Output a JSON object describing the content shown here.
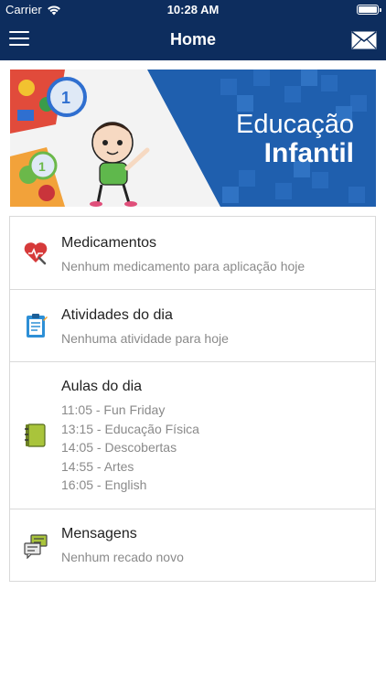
{
  "status_bar": {
    "carrier": "Carrier",
    "time": "10:28 AM"
  },
  "nav": {
    "title": "Home",
    "menu_icon": "hamburger-icon",
    "mail_icon": "envelope-icon"
  },
  "banner": {
    "line1": "Educação",
    "line2": "Infantil"
  },
  "sections": {
    "medicamentos": {
      "title": "Medicamentos",
      "subtitle": "Nenhum medicamento para aplicação hoje",
      "icon": "heart-pill-icon"
    },
    "atividades": {
      "title": "Atividades do dia",
      "subtitle": "Nenhuma atividade para hoje",
      "icon": "clipboard-icon"
    },
    "aulas": {
      "title": "Aulas do dia",
      "icon": "notebook-icon",
      "items": [
        "11:05 - Fun Friday",
        "13:15 - Educação Física",
        "14:05 - Descobertas",
        "14:55 - Artes",
        "16:05 - English"
      ]
    },
    "mensagens": {
      "title": "Mensagens",
      "subtitle": "Nenhum recado novo",
      "icon": "chat-bubbles-icon"
    }
  },
  "colors": {
    "nav_bg": "#0d2d5e",
    "banner_bg": "#1f5fae",
    "divider": "#d9d9d9",
    "subtext": "#8a8a8a"
  }
}
